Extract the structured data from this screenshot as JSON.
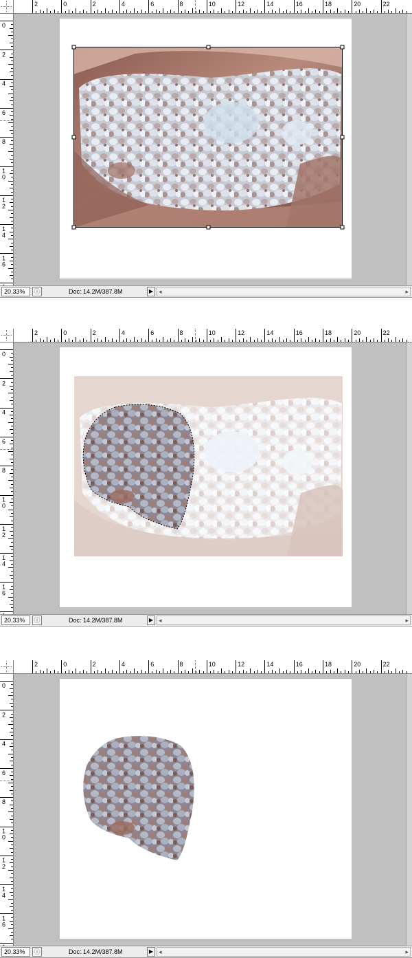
{
  "ruler": {
    "h_labels": [
      "2",
      "0",
      "2",
      "4",
      "6",
      "8",
      "10",
      "12",
      "14",
      "16",
      "18",
      "20",
      "22"
    ],
    "v_labels": [
      "0",
      "2",
      "4",
      "6",
      "8",
      "1\n0",
      "1\n2",
      "1\n4",
      "1\n6",
      "1"
    ]
  },
  "panels": [
    {
      "state": "photo-selected-with-transform-handles",
      "status": {
        "zoom": "20.33%",
        "doc": "Doc: 14.2M/387.8M",
        "arrow": "▶",
        "scroll_left": "◂",
        "scroll_right": "▸"
      }
    },
    {
      "state": "lasso-selection-on-faded-photo",
      "status": {
        "zoom": "20.33%",
        "doc": "Doc: 14.2M/387.8M",
        "arrow": "▶",
        "scroll_left": "◂",
        "scroll_right": "▸"
      }
    },
    {
      "state": "cutout-only-on-white-page",
      "status": {
        "zoom": "20.33%",
        "doc": "Doc: 14.2M/387.8M",
        "arrow": "▶",
        "scroll_left": "◂",
        "scroll_right": "▸"
      }
    }
  ],
  "icons": {
    "status_icon": "ⓘ"
  }
}
